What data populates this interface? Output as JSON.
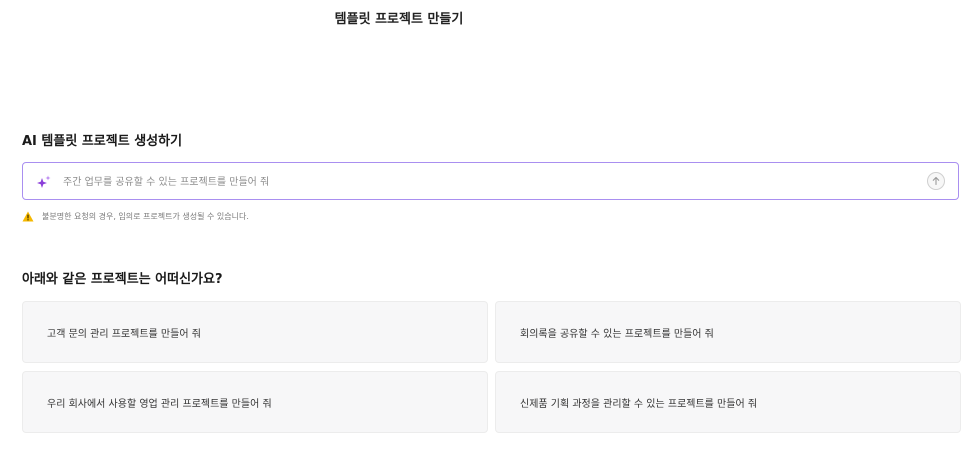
{
  "header": {
    "title": "템플릿 프로젝트 만들기"
  },
  "ai_section": {
    "title": "AI 템플릿 프로젝트 생성하기",
    "input": {
      "placeholder": "주간 업무를 공유할 수 있는 프로젝트를 만들어 줘",
      "value": ""
    },
    "input_icon": "sparkle-icon",
    "send_icon": "arrow-up-icon",
    "accent_color": "#8b3fd9",
    "warning_icon": "warning-icon",
    "warning_color": "#f5b800",
    "warning": "불분명한 요청의 경우, 임의로 프로젝트가 생성될 수 있습니다."
  },
  "suggestions": {
    "title": "아래와 같은 프로젝트는 어떠신가요?",
    "items": [
      "고객 문의 관리 프로젝트를 만들어 줘",
      "회의록을 공유할 수 있는 프로젝트를 만들어 줘",
      "우리 회사에서 사용할 영업 관리 프로젝트를 만들어 줘",
      "신제품 기획 과정을 관리할 수 있는 프로젝트를 만들어 줘"
    ]
  }
}
